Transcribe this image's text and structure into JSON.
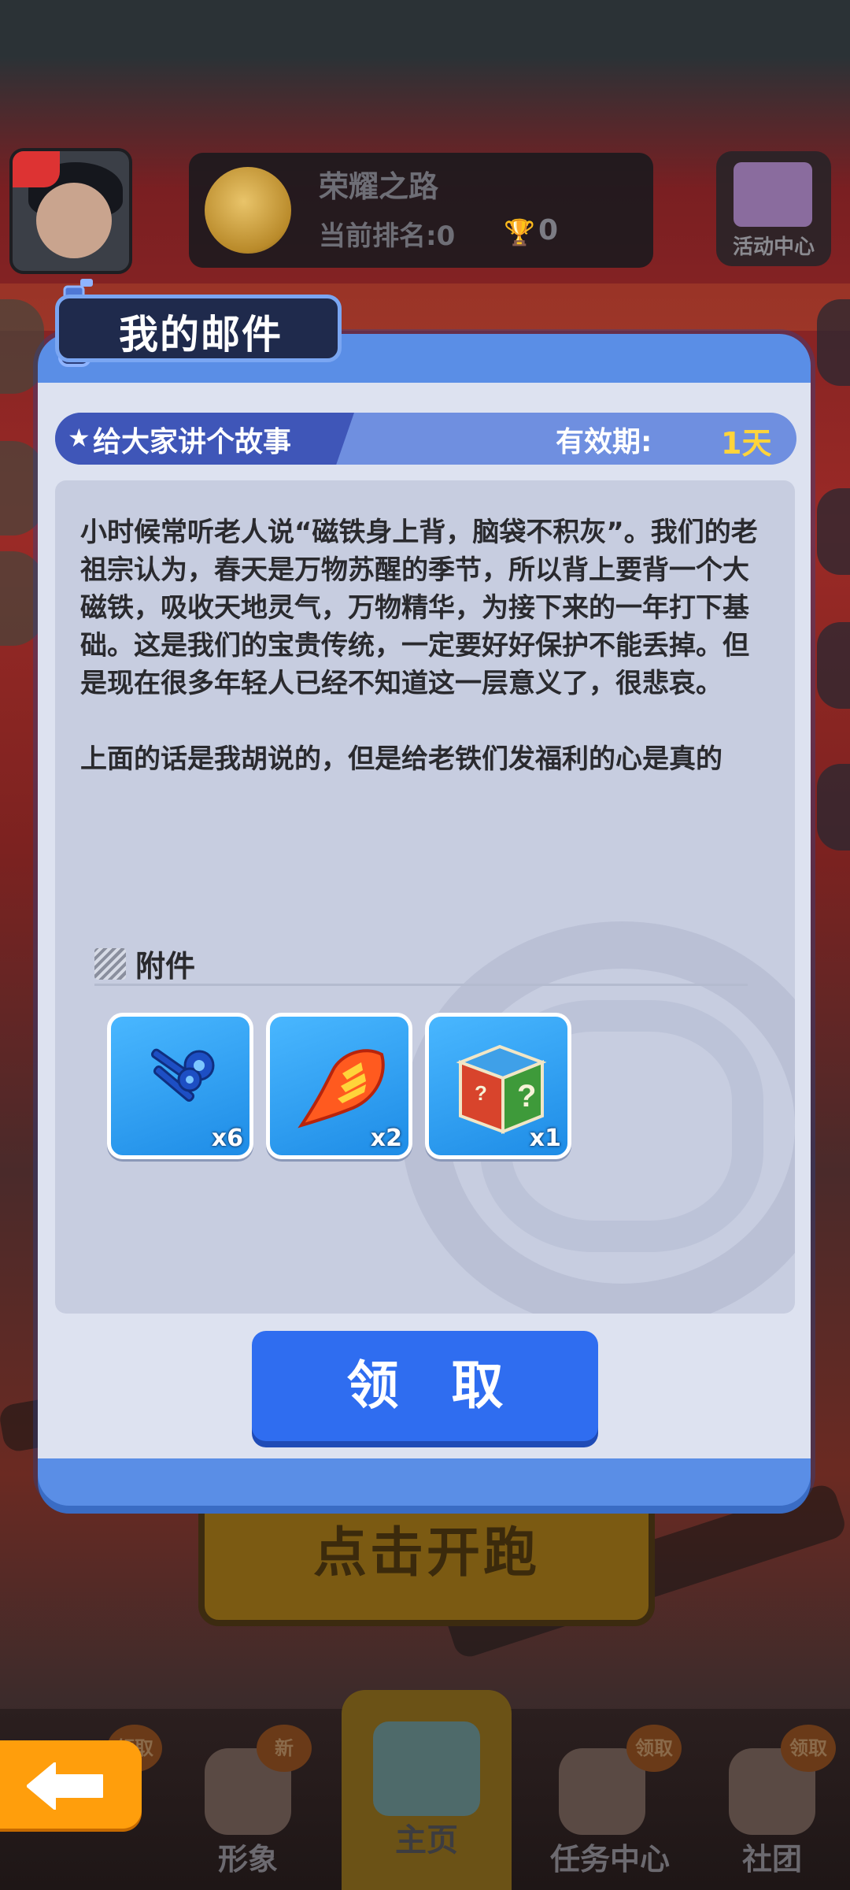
{
  "background": {
    "glory_panel": {
      "title": "荣耀之路",
      "rank_text": "当前排名:0",
      "trophy_count": "0"
    },
    "activity_center_label": "活动中心",
    "run_button_label": "点击开跑"
  },
  "bottom_nav": {
    "items": [
      {
        "label": "形象",
        "badge": "新",
        "icon": "character-icon"
      },
      {
        "label": "主页",
        "badge": "",
        "icon": "skateboard-icon"
      },
      {
        "label": "任务中心",
        "badge": "领取",
        "icon": "trophy-icon"
      },
      {
        "label": "社团",
        "badge": "领取",
        "icon": "club-icon"
      }
    ],
    "first_badge": "领取",
    "back_label": "Back"
  },
  "mail": {
    "title": "我的邮件",
    "subject": "给大家讲个故事",
    "validity_label": "有效期:",
    "validity_value": "1天",
    "body": "小时候常听老人说“磁铁身上背，脑袋不积灰”。我们的老祖宗认为，春天是万物苏醒的季节，所以背上要背一个大磁铁，吸收天地灵气，万物精华，为接下来的一年打下基础。这是我们的宝贵传统，一定要好好保护不能丢掉。但是现在很多年轻人已经不知道这一层意义了，很悲哀。\n\n上面的话是我胡说的，但是给老铁们发福利的心是真的",
    "attachments_label": "附件",
    "attachments": [
      {
        "icon": "keys-icon",
        "count": "x6"
      },
      {
        "icon": "fire-boost-icon",
        "count": "x2"
      },
      {
        "icon": "mystery-box-icon",
        "count": "x1"
      }
    ],
    "claim_label": "领 取"
  },
  "colors": {
    "modal_frame": "#5a8ee6",
    "claim_button": "#2f6df0",
    "validity_accent": "#ffd43a",
    "back_button": "#ff9e0c"
  }
}
